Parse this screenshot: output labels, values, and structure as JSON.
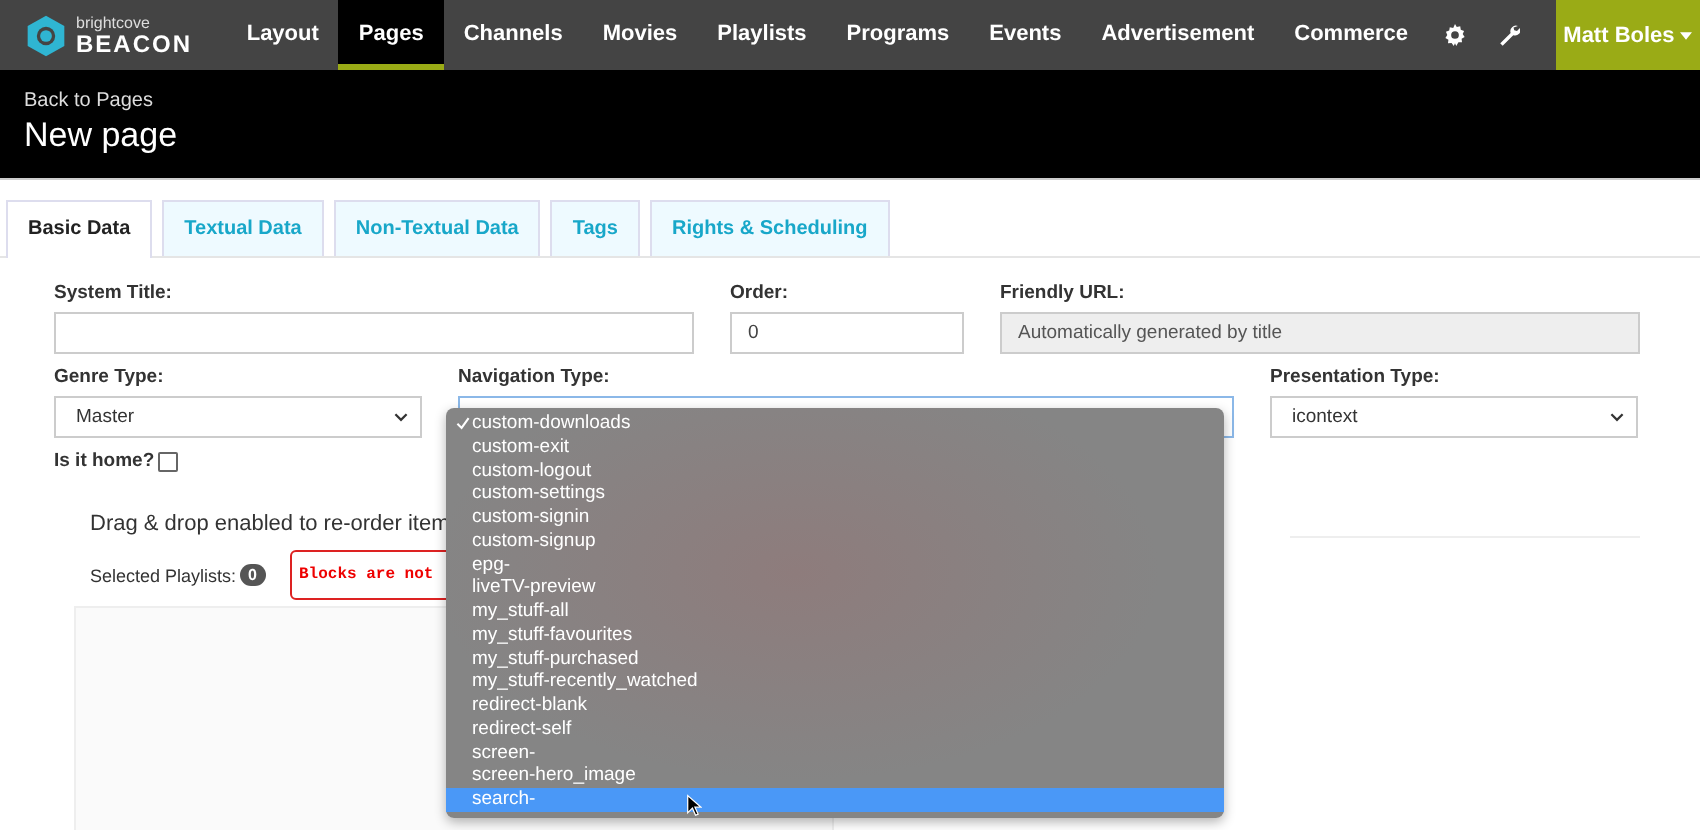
{
  "logo": {
    "top": "brightcove",
    "bottom": "BEACON"
  },
  "nav": [
    {
      "label": "Layout",
      "selected": false
    },
    {
      "label": "Pages",
      "selected": true
    },
    {
      "label": "Channels",
      "selected": false
    },
    {
      "label": "Movies",
      "selected": false
    },
    {
      "label": "Playlists",
      "selected": false
    },
    {
      "label": "Programs",
      "selected": false
    },
    {
      "label": "Events",
      "selected": false
    },
    {
      "label": "Advertisement",
      "selected": false
    },
    {
      "label": "Commerce",
      "selected": false
    }
  ],
  "user_menu": {
    "label": "Matt Boles"
  },
  "header": {
    "back_link": "Back to Pages",
    "title": "New page"
  },
  "tabs": [
    {
      "label": "Basic Data",
      "selected": true
    },
    {
      "label": "Textual Data",
      "selected": false
    },
    {
      "label": "Non-Textual Data",
      "selected": false
    },
    {
      "label": "Tags",
      "selected": false
    },
    {
      "label": "Rights & Scheduling",
      "selected": false
    }
  ],
  "form": {
    "system_title": {
      "label": "System Title:"
    },
    "order": {
      "label": "Order:",
      "value": "0"
    },
    "friendly_url": {
      "label": "Friendly URL:",
      "placeholder": "Automatically generated by title",
      "disabled": true
    },
    "genre_type": {
      "label": "Genre Type:",
      "value": "Master"
    },
    "navigation_type": {
      "label": "Navigation Type:"
    },
    "presentation_type": {
      "label": "Presentation Type:",
      "value": "icontext"
    },
    "is_home": {
      "label": "Is it home?",
      "checked": false
    }
  },
  "playlists": {
    "hint": "Drag & drop enabled to re-order item",
    "selected_label": "Selected Playlists:",
    "selected_count": "0",
    "warning": "Blocks are not"
  },
  "dropdown": [
    {
      "label": "custom-downloads",
      "checked": true,
      "highlighted": false
    },
    {
      "label": "custom-exit",
      "checked": false,
      "highlighted": false
    },
    {
      "label": "custom-logout",
      "checked": false,
      "highlighted": false
    },
    {
      "label": "custom-settings",
      "checked": false,
      "highlighted": false
    },
    {
      "label": "custom-signin",
      "checked": false,
      "highlighted": false
    },
    {
      "label": "custom-signup",
      "checked": false,
      "highlighted": false
    },
    {
      "label": "epg-",
      "checked": false,
      "highlighted": false
    },
    {
      "label": "liveTV-preview",
      "checked": false,
      "highlighted": false
    },
    {
      "label": "my_stuff-all",
      "checked": false,
      "highlighted": false
    },
    {
      "label": "my_stuff-favourites",
      "checked": false,
      "highlighted": false
    },
    {
      "label": "my_stuff-purchased",
      "checked": false,
      "highlighted": false
    },
    {
      "label": "my_stuff-recently_watched",
      "checked": false,
      "highlighted": false
    },
    {
      "label": "redirect-blank",
      "checked": false,
      "highlighted": false
    },
    {
      "label": "redirect-self",
      "checked": false,
      "highlighted": false
    },
    {
      "label": "screen-",
      "checked": false,
      "highlighted": false
    },
    {
      "label": "screen-hero_image",
      "checked": false,
      "highlighted": false
    },
    {
      "label": "search-",
      "checked": false,
      "highlighted": true
    }
  ]
}
